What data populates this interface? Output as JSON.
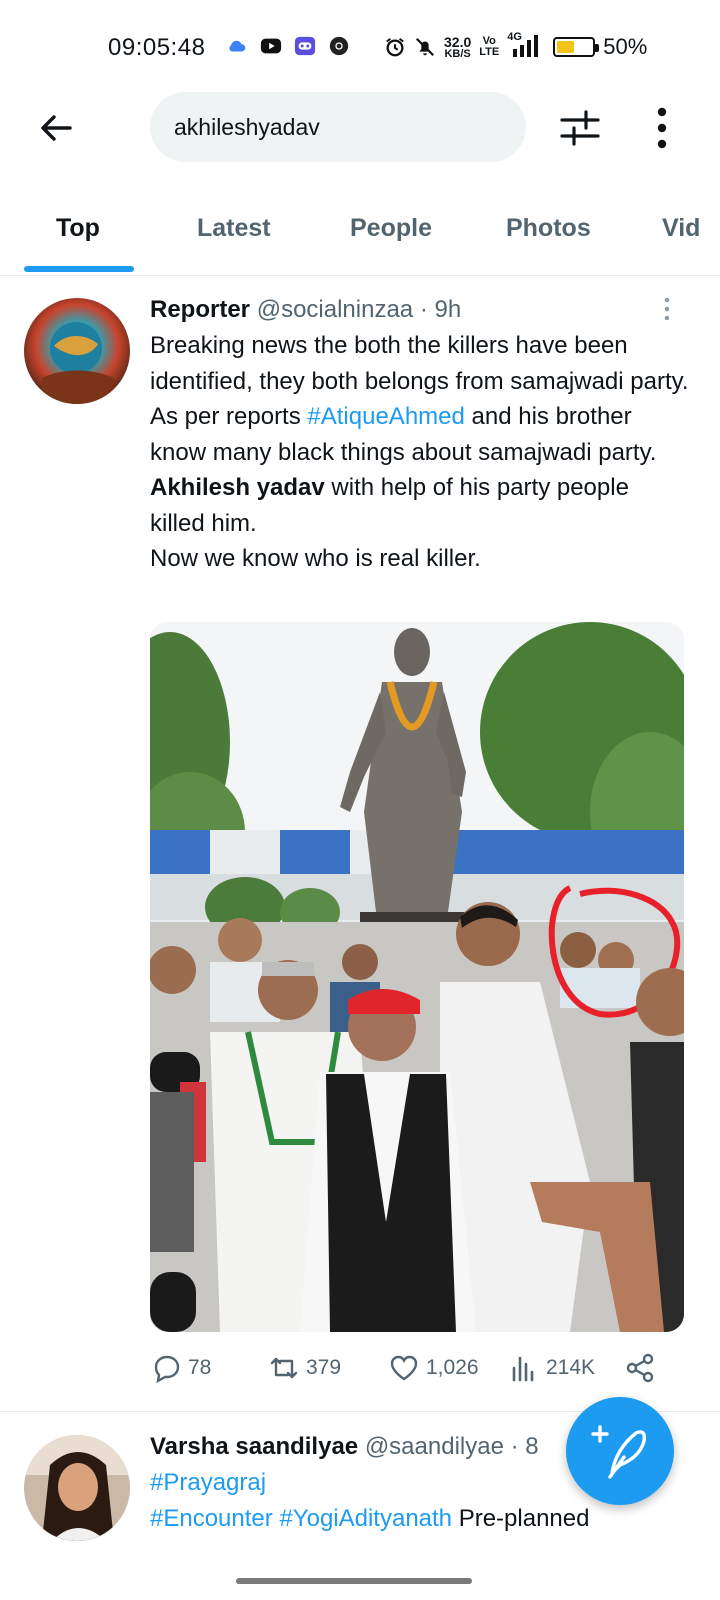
{
  "status_bar": {
    "time": "09:05:48",
    "net_speed_value": "32.0",
    "net_speed_unit": "KB/S",
    "volte_label_top": "Vo",
    "volte_label_bottom": "LTE",
    "network_type": "4G",
    "battery_percent_text": "50%",
    "battery_level": 0.5,
    "icons": [
      "cloud-icon",
      "youtube-icon",
      "game-icon",
      "chrome-icon",
      "alarm-icon",
      "mute-icon",
      "signal-icon",
      "battery-icon"
    ]
  },
  "search": {
    "query": "akhileshyadav",
    "icons": [
      "back-arrow-icon",
      "filter-sliders-icon",
      "more-vertical-icon"
    ]
  },
  "tabs": [
    {
      "label": "Top",
      "active": true
    },
    {
      "label": "Latest",
      "active": false
    },
    {
      "label": "People",
      "active": false
    },
    {
      "label": "Photos",
      "active": false
    },
    {
      "label": "Vid",
      "active": false
    }
  ],
  "tweet": {
    "name": "Reporter",
    "handle": "@socialninzaa",
    "separator": "·",
    "time": "9h",
    "text_line1": "Breaking news the both the killers have been identified, they both belongs from samajwadi party. As per reports ",
    "hashtag1": "#AtiqueAhmed",
    "text_line2": " and his brother know many black things about samajwadi party.",
    "bold_name": "Akhilesh yadav",
    "text_line3": " with help of his party people killed him.",
    "text_line4": "Now we know who is real killer.",
    "stats": {
      "replies": "78",
      "retweets": "379",
      "likes": "1,026",
      "views": "214K"
    },
    "accent_color": "#1d9bf0",
    "highlight_circle_color": "#e8202a"
  },
  "tweet2": {
    "name": "Varsha saandilyae",
    "handle": "@saandilyae",
    "separator": "·",
    "time": "8",
    "hashtag1": "#Prayagraj",
    "hashtag2": "#Encounter",
    "hashtag3": "#YogiAdityanath",
    "text_tail": " Pre-planned"
  },
  "fab": {
    "icon": "compose-feather-plus-icon"
  }
}
